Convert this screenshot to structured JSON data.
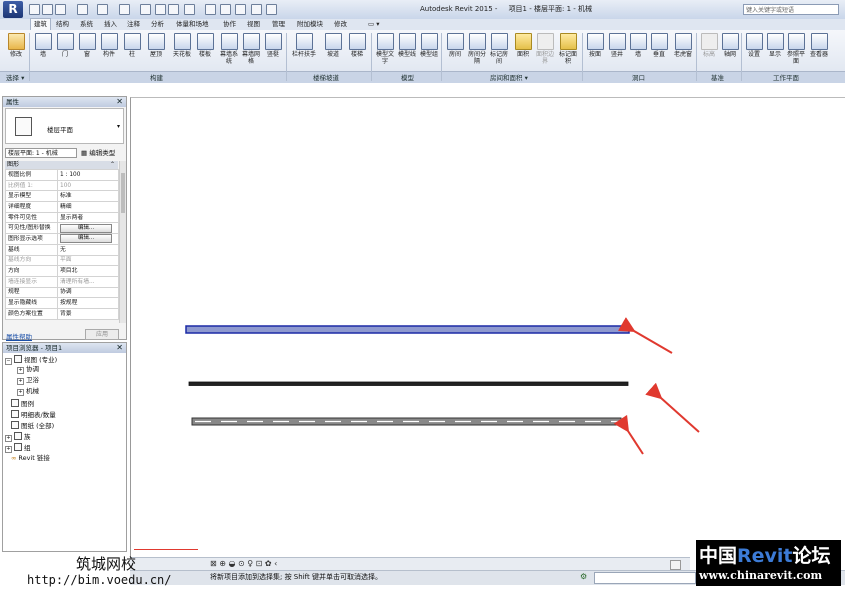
{
  "app": {
    "logo": "R",
    "title": "Autodesk Revit 2015 -",
    "document": "项目1 - 楼层平面: 1 - 机械",
    "search_placeholder": "键入关键字或短语"
  },
  "tabs": [
    "建筑",
    "结构",
    "系统",
    "插入",
    "注释",
    "分析",
    "体量和场地",
    "协作",
    "视图",
    "管理",
    "附加模块",
    "修改"
  ],
  "ribbon": {
    "buttons": [
      {
        "label": "修改",
        "icon": "cursor-arrow-icon"
      },
      {
        "label": "墙",
        "icon": "wall-icon"
      },
      {
        "label": "门",
        "icon": "door-icon"
      },
      {
        "label": "窗",
        "icon": "window-icon"
      },
      {
        "label": "构件",
        "icon": "component-icon"
      },
      {
        "label": "柱",
        "icon": "column-icon"
      },
      {
        "label": "屋顶",
        "icon": "roof-icon"
      },
      {
        "label": "天花板",
        "icon": "ceiling-icon"
      },
      {
        "label": "楼板",
        "icon": "floor-icon"
      },
      {
        "label": "幕墙系统",
        "icon": "curtain-system-icon"
      },
      {
        "label": "幕墙网格",
        "icon": "curtain-grid-icon"
      },
      {
        "label": "竖梃",
        "icon": "mullion-icon"
      },
      {
        "label": "栏杆扶手",
        "icon": "railing-icon"
      },
      {
        "label": "坡道",
        "icon": "ramp-icon"
      },
      {
        "label": "楼梯",
        "icon": "stair-icon"
      },
      {
        "label": "模型文字",
        "icon": "model-text-icon"
      },
      {
        "label": "模型线",
        "icon": "model-line-icon"
      },
      {
        "label": "模型组",
        "icon": "model-group-icon"
      },
      {
        "label": "房间",
        "icon": "room-icon"
      },
      {
        "label": "房间分隔",
        "icon": "room-separator-icon"
      },
      {
        "label": "标记房间",
        "icon": "tag-room-icon"
      },
      {
        "label": "面积",
        "icon": "area-icon"
      },
      {
        "label": "面积边界",
        "icon": "area-boundary-icon"
      },
      {
        "label": "标记面积",
        "icon": "tag-area-icon"
      },
      {
        "label": "按面",
        "icon": "by-face-icon"
      },
      {
        "label": "竖井",
        "icon": "shaft-icon"
      },
      {
        "label": "墙",
        "icon": "wall-opening-icon"
      },
      {
        "label": "垂直",
        "icon": "vertical-opening-icon"
      },
      {
        "label": "老虎窗",
        "icon": "dormer-icon"
      },
      {
        "label": "标高",
        "icon": "level-icon"
      },
      {
        "label": "轴网",
        "icon": "grid-icon"
      },
      {
        "label": "设置",
        "icon": "set-workplane-icon"
      },
      {
        "label": "显示",
        "icon": "show-workplane-icon"
      },
      {
        "label": "参照平面",
        "icon": "ref-plane-icon"
      },
      {
        "label": "查看器",
        "icon": "viewer-icon"
      }
    ],
    "panels": [
      "选择 ▾",
      "构建",
      "楼梯坡道",
      "模型",
      "房间和面积 ▾",
      "洞口",
      "基准",
      "工作平面"
    ]
  },
  "properties": {
    "title": "属性",
    "type_name": "楼层平面",
    "instance_selector": "楼层平面: 1 - 机械",
    "edit_type": "编辑类型",
    "section": "图形",
    "rows": [
      {
        "name": "视图比例",
        "value": "1 : 100"
      },
      {
        "name": "比例值 1:",
        "value": "100"
      },
      {
        "name": "显示模型",
        "value": "标准"
      },
      {
        "name": "详细程度",
        "value": "精细"
      },
      {
        "name": "零件可见性",
        "value": "显示两者"
      },
      {
        "name": "可见性/图形替换",
        "value": "编辑..."
      },
      {
        "name": "图形显示选项",
        "value": "编辑..."
      },
      {
        "name": "基线",
        "value": "无"
      },
      {
        "name": "基线方向",
        "value": "平面"
      },
      {
        "name": "方向",
        "value": "项目北"
      },
      {
        "name": "墙连接显示",
        "value": "清理所有墙..."
      },
      {
        "name": "规程",
        "value": "协调"
      },
      {
        "name": "显示隐藏线",
        "value": "按规程"
      },
      {
        "name": "颜色方案位置",
        "value": "背景"
      }
    ],
    "help": "属性帮助",
    "apply": "应用"
  },
  "browser": {
    "title": "项目浏览器 - 项目1",
    "items": [
      "视图 (专业)",
      "协调",
      "卫浴",
      "机械",
      "图例",
      "明细表/数量",
      "图纸 (全部)",
      "族",
      "组",
      "Revit 链接"
    ]
  },
  "statusbar": {
    "text": "将新项目添加到选择集; 按 Shift 键并单击可取消选择。"
  },
  "watermarks": {
    "left_name": "筑城网校",
    "left_url": "http://bim.voedu.cn/",
    "right_prefix": "中国",
    "right_brand": "Revit",
    "right_suffix": "论坛",
    "right_url": "www.chinarevit.com"
  },
  "colors": {
    "selected_line_fill": "#8e99cf",
    "selected_line_stroke": "#1b2aa6",
    "arrow": "#e0392f"
  }
}
